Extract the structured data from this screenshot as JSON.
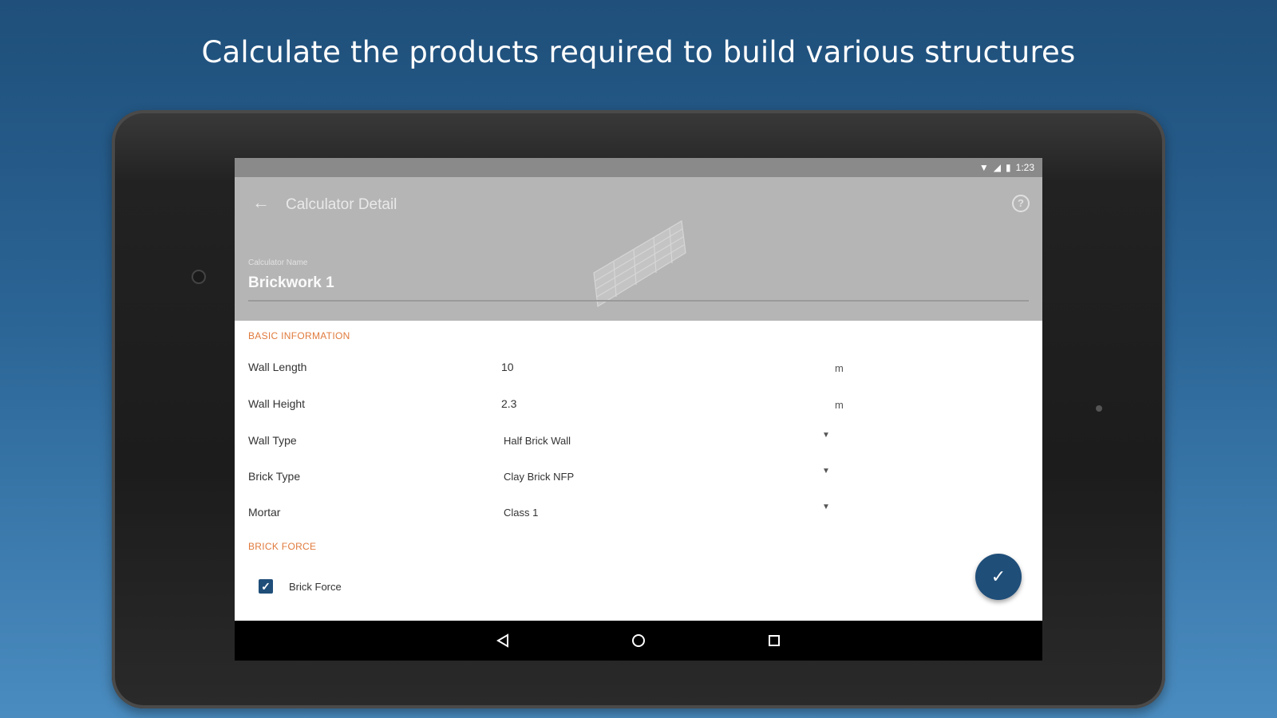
{
  "headline": "Calculate the products required to build various structures",
  "status_bar": {
    "time": "1:23"
  },
  "app_bar": {
    "title": "Calculator Detail",
    "back_icon": "arrow-left-icon",
    "help_icon": "help-circle-icon"
  },
  "calculator_name": {
    "caption": "Calculator Name",
    "value": "Brickwork 1"
  },
  "sections": {
    "basic": "BASIC INFORMATION",
    "brick_force": "BRICK FORCE"
  },
  "fields": {
    "wall_length": {
      "label": "Wall Length",
      "value": "10",
      "unit": "m"
    },
    "wall_height": {
      "label": "Wall Height",
      "value": "2.3",
      "unit": "m"
    },
    "wall_type": {
      "label": "Wall Type",
      "value": "Half Brick Wall"
    },
    "brick_type": {
      "label": "Brick Type",
      "value": "Clay Brick NFP"
    },
    "mortar": {
      "label": "Mortar",
      "value": "Class 1"
    }
  },
  "brick_force_checkbox": {
    "label": "Brick Force",
    "checked": true
  },
  "fab": {
    "icon": "check-icon"
  },
  "colors": {
    "accent": "#e07a3c",
    "primary": "#1f4e79",
    "app_bar": "#b5b5b5"
  }
}
